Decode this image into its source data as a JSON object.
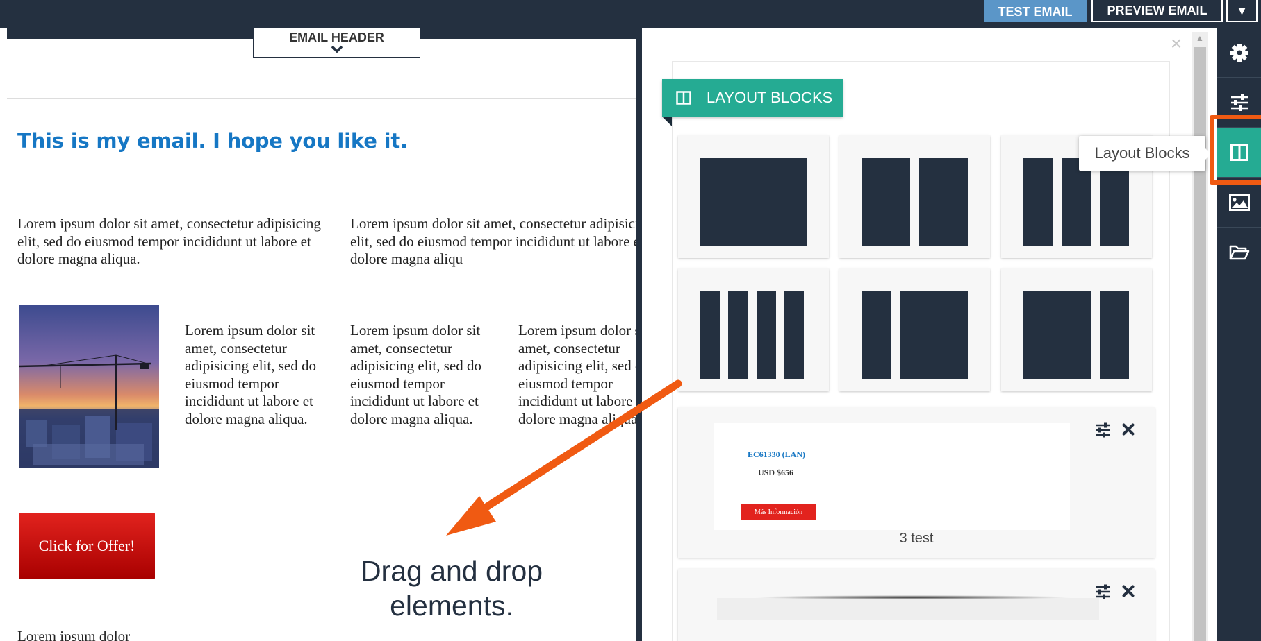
{
  "toolbar": {
    "test_email_label": "TEST EMAIL",
    "preview_email_label": "PREVIEW EMAIL",
    "extra_label": "▾"
  },
  "canvas": {
    "email_header_label": "EMAIL HEADER",
    "headline": "This is my email. I hope you like it.",
    "paragraph_a": "Lorem ipsum dolor sit amet, consectetur adipisicing elit, sed do eiusmod tempor incididunt ut labore et dolore magna aliqua.",
    "paragraph_b": "Lorem ipsum dolor sit amet, consectetur adipisicing elit, sed do eiusmod tempor incididunt ut labore et dolore magna aliqu",
    "columns": [
      "Lorem ipsum dolor sit amet, consectetur adipisicing elit, sed do eiusmod tempor incididunt ut labore et dolore magna aliqua.",
      "Lorem ipsum dolor sit amet, consectetur adipisicing elit, sed do eiusmod tempor incididunt ut labore et dolore magna aliqua.",
      "Lorem ipsum dolor sit amet, consectetur adipisicing elit, sed do eiusmod tempor incididunt ut labore et dolore magna aliqua."
    ],
    "cta_label": "Click for Offer!",
    "bottom_text": "Lorem ipsum dolor",
    "drag_drop_note": "Drag and drop elements."
  },
  "panel": {
    "section_title": "LAYOUT BLOCKS",
    "close_icon": "close-icon",
    "saved_blocks": [
      {
        "preview_code": "EC61330 (LAN)",
        "preview_price": "USD $656",
        "preview_button": "Más Información",
        "label": "3 test"
      }
    ]
  },
  "tooltip": {
    "label": "Layout Blocks"
  },
  "rail": {
    "items": [
      "gear-icon",
      "sliders-icon",
      "columns-icon",
      "image-icon",
      "folder-open-icon"
    ],
    "active_index": 2
  },
  "colors": {
    "navy": "#243040",
    "teal": "#25ab93",
    "headline_blue": "#1677c4",
    "cta_red": "#e2231e",
    "annotation_orange": "#f05a12",
    "test_email_blue": "#5b96c8"
  }
}
